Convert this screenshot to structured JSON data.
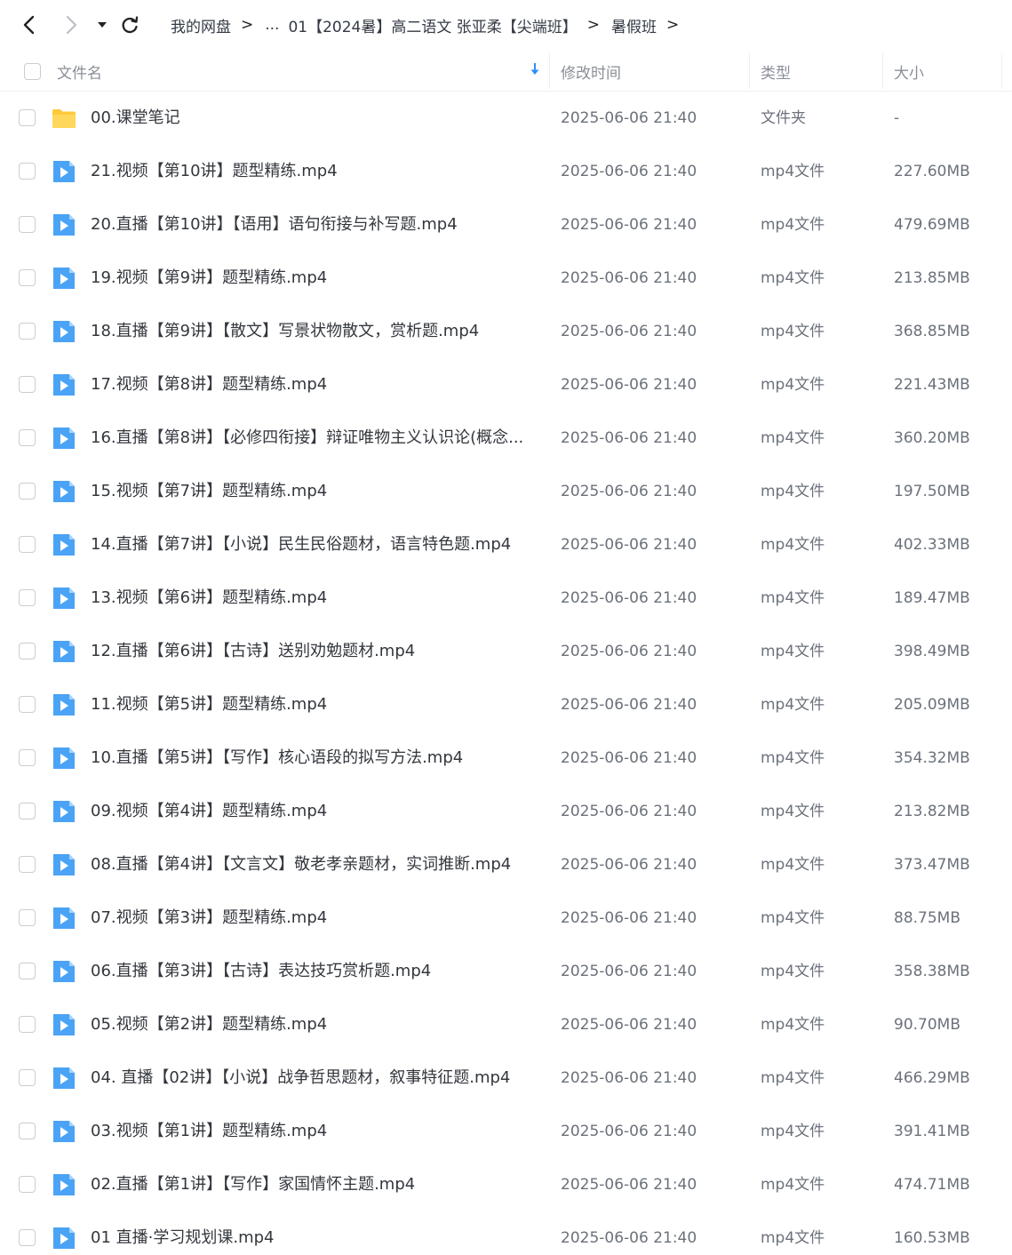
{
  "toolbar": {
    "back_icon": "chevron-left-icon",
    "forward_icon": "chevron-right-icon",
    "history_icon": "caret-down-icon",
    "refresh_icon": "refresh-icon"
  },
  "breadcrumb": {
    "root": "我的网盘",
    "ellipsis": "...",
    "parent": "01【2024暑】高二语文 张亚柔【尖端班】",
    "current": "暑假班",
    "separator": ">"
  },
  "table": {
    "headers": {
      "name": "文件名",
      "modified": "修改时间",
      "type": "类型",
      "size": "大小"
    },
    "rows": [
      {
        "name": "00.课堂笔记",
        "time": "2025-06-06 21:40",
        "type": "文件夹",
        "size": "-",
        "icon": "folder"
      },
      {
        "name": "21.视频【第10讲】题型精练.mp4",
        "time": "2025-06-06 21:40",
        "type": "mp4文件",
        "size": "227.60MB",
        "icon": "video"
      },
      {
        "name": "20.直播【第10讲】【语用】语句衔接与补写题.mp4",
        "time": "2025-06-06 21:40",
        "type": "mp4文件",
        "size": "479.69MB",
        "icon": "video"
      },
      {
        "name": "19.视频【第9讲】题型精练.mp4",
        "time": "2025-06-06 21:40",
        "type": "mp4文件",
        "size": "213.85MB",
        "icon": "video"
      },
      {
        "name": "18.直播【第9讲】【散文】写景状物散文，赏析题.mp4",
        "time": "2025-06-06 21:40",
        "type": "mp4文件",
        "size": "368.85MB",
        "icon": "video"
      },
      {
        "name": "17.视频【第8讲】题型精练.mp4",
        "time": "2025-06-06 21:40",
        "type": "mp4文件",
        "size": "221.43MB",
        "icon": "video"
      },
      {
        "name": "16.直播【第8讲】【必修四衔接】辩证唯物主义认识论(概念...",
        "time": "2025-06-06 21:40",
        "type": "mp4文件",
        "size": "360.20MB",
        "icon": "video"
      },
      {
        "name": "15.视频【第7讲】题型精练.mp4",
        "time": "2025-06-06 21:40",
        "type": "mp4文件",
        "size": "197.50MB",
        "icon": "video"
      },
      {
        "name": "14.直播【第7讲】【小说】民生民俗题材，语言特色题.mp4",
        "time": "2025-06-06 21:40",
        "type": "mp4文件",
        "size": "402.33MB",
        "icon": "video"
      },
      {
        "name": "13.视频【第6讲】题型精练.mp4",
        "time": "2025-06-06 21:40",
        "type": "mp4文件",
        "size": "189.47MB",
        "icon": "video"
      },
      {
        "name": "12.直播【第6讲】【古诗】送别劝勉题材.mp4",
        "time": "2025-06-06 21:40",
        "type": "mp4文件",
        "size": "398.49MB",
        "icon": "video"
      },
      {
        "name": "11.视频【第5讲】题型精练.mp4",
        "time": "2025-06-06 21:40",
        "type": "mp4文件",
        "size": "205.09MB",
        "icon": "video"
      },
      {
        "name": "10.直播【第5讲】【写作】核心语段的拟写方法.mp4",
        "time": "2025-06-06 21:40",
        "type": "mp4文件",
        "size": "354.32MB",
        "icon": "video"
      },
      {
        "name": "09.视频【第4讲】题型精练.mp4",
        "time": "2025-06-06 21:40",
        "type": "mp4文件",
        "size": "213.82MB",
        "icon": "video"
      },
      {
        "name": "08.直播【第4讲】【文言文】敬老孝亲题材，实词推断.mp4",
        "time": "2025-06-06 21:40",
        "type": "mp4文件",
        "size": "373.47MB",
        "icon": "video"
      },
      {
        "name": "07.视频【第3讲】题型精练.mp4",
        "time": "2025-06-06 21:40",
        "type": "mp4文件",
        "size": "88.75MB",
        "icon": "video"
      },
      {
        "name": "06.直播【第3讲】【古诗】表达技巧赏析题.mp4",
        "time": "2025-06-06 21:40",
        "type": "mp4文件",
        "size": "358.38MB",
        "icon": "video"
      },
      {
        "name": "05.视频【第2讲】题型精练.mp4",
        "time": "2025-06-06 21:40",
        "type": "mp4文件",
        "size": "90.70MB",
        "icon": "video"
      },
      {
        "name": "04. 直播【02讲】【小说】战争哲思题材，叙事特征题.mp4",
        "time": "2025-06-06 21:40",
        "type": "mp4文件",
        "size": "466.29MB",
        "icon": "video"
      },
      {
        "name": "03.视频【第1讲】题型精练.mp4",
        "time": "2025-06-06 21:40",
        "type": "mp4文件",
        "size": "391.41MB",
        "icon": "video"
      },
      {
        "name": "02.直播【第1讲】【写作】家国情怀主题.mp4",
        "time": "2025-06-06 21:40",
        "type": "mp4文件",
        "size": "474.71MB",
        "icon": "video"
      },
      {
        "name": "01 直播·学习规划课.mp4",
        "time": "2025-06-06 21:40",
        "type": "mp4文件",
        "size": "160.53MB",
        "icon": "video"
      }
    ]
  },
  "colors": {
    "accent": "#2f8ef7",
    "video_icon": "#4aa3f5",
    "folder": "#ffc93b"
  }
}
